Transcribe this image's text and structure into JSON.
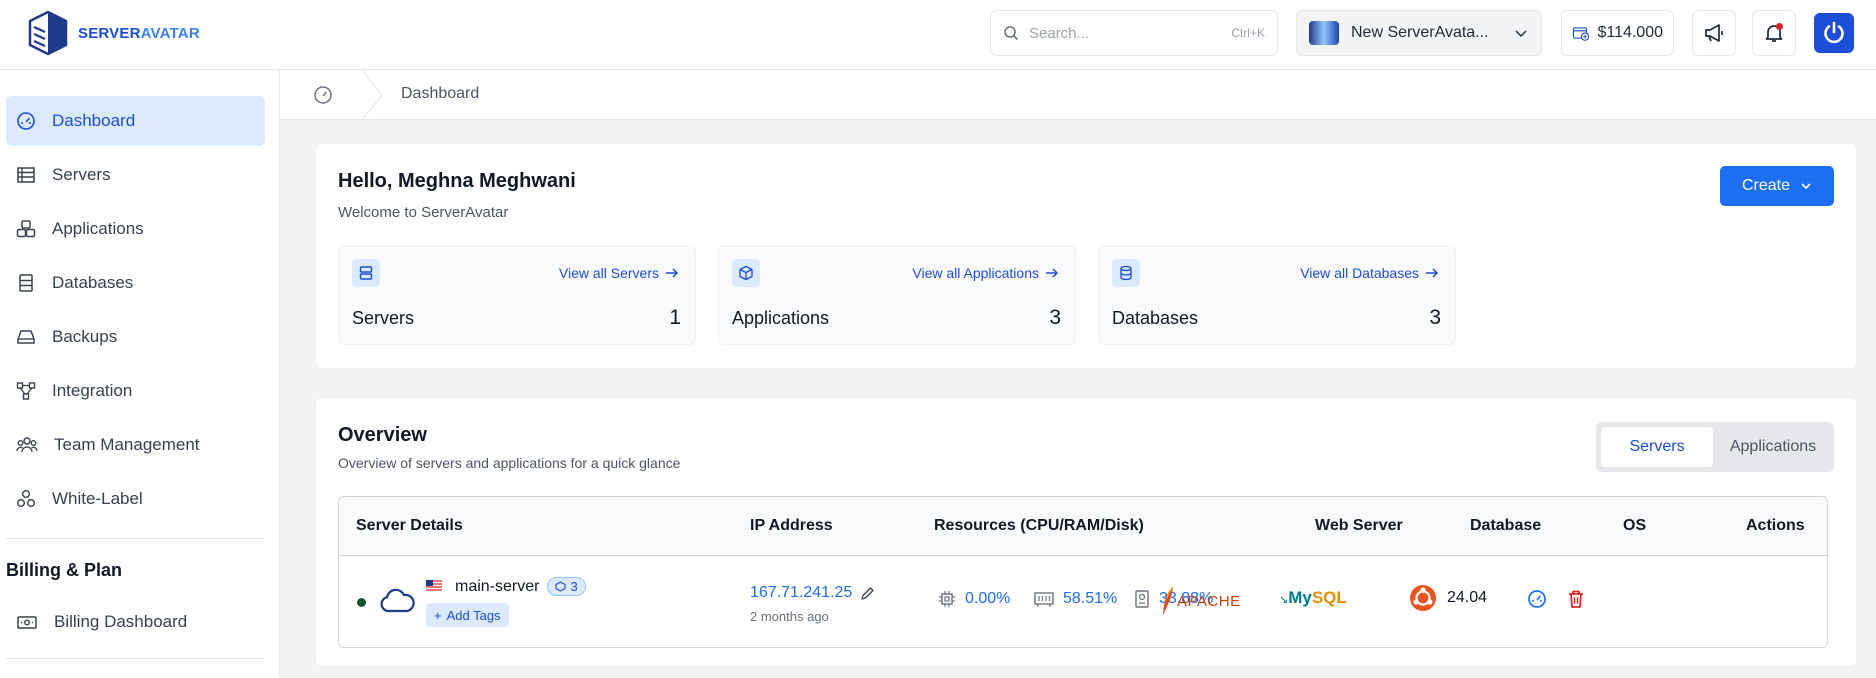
{
  "brand": {
    "name_part1": "SERVER",
    "name_part2": "AVATAR"
  },
  "search": {
    "placeholder": "Search...",
    "shortcut": "Ctrl+K"
  },
  "workspace": {
    "name": "New ServerAvata..."
  },
  "credit": {
    "amount": "$114.000"
  },
  "sidebar": {
    "items": [
      {
        "label": "Dashboard",
        "icon": "gauge-icon",
        "active": true
      },
      {
        "label": "Servers",
        "icon": "server-list-icon"
      },
      {
        "label": "Applications",
        "icon": "cubes-icon"
      },
      {
        "label": "Databases",
        "icon": "database-icon"
      },
      {
        "label": "Backups",
        "icon": "drive-icon"
      },
      {
        "label": "Integration",
        "icon": "flow-icon"
      },
      {
        "label": "Team Management",
        "icon": "team-icon"
      },
      {
        "label": "White-Label",
        "icon": "shapes-icon"
      }
    ],
    "billing_title": "Billing & Plan",
    "billing_items": [
      {
        "label": "Billing Dashboard",
        "icon": "money-icon"
      }
    ]
  },
  "breadcrumb": {
    "current": "Dashboard"
  },
  "welcome": {
    "greeting": "Hello, Meghna Meghwani",
    "subtitle": "Welcome to ServerAvatar",
    "create_label": "Create"
  },
  "stats": [
    {
      "label": "Servers",
      "count": "1",
      "link": "View all Servers"
    },
    {
      "label": "Applications",
      "count": "3",
      "link": "View all Applications"
    },
    {
      "label": "Databases",
      "count": "3",
      "link": "View all Databases"
    }
  ],
  "overview": {
    "title": "Overview",
    "subtitle": "Overview of servers and applications for a quick glance",
    "tabs": [
      {
        "label": "Servers",
        "active": true
      },
      {
        "label": "Applications"
      }
    ],
    "columns": [
      "Server Details",
      "IP Address",
      "Resources (CPU/RAM/Disk)",
      "Web Server",
      "Database",
      "OS",
      "Actions"
    ],
    "rows": [
      {
        "name": "main-server",
        "tag_count": "3",
        "add_tags": "Add Tags",
        "ip": "167.71.241.25",
        "ip_age": "2 months ago",
        "cpu": "0.00%",
        "ram": "58.51%",
        "disk": "33.88%",
        "web_server": "APACHE",
        "database_a": "My",
        "database_b": "SQL",
        "os_version": "24.04",
        "status_color": "#14532d"
      }
    ]
  },
  "colors": {
    "accent": "#1d6ff2",
    "active_nav_bg": "#dbeafe",
    "delete": "#dc2626"
  }
}
